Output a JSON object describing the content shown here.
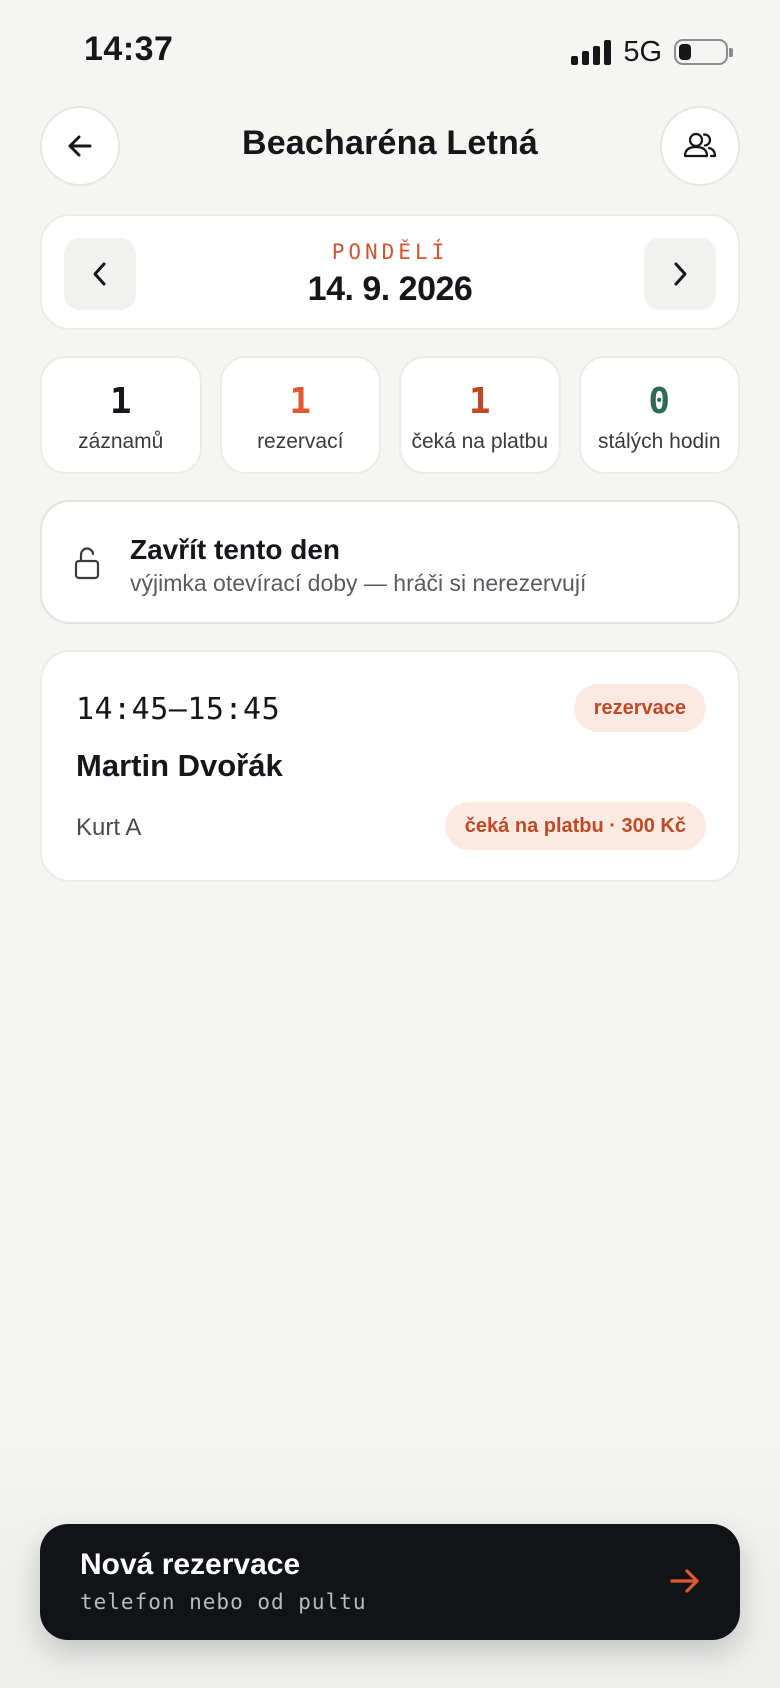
{
  "status_bar": {
    "time": "14:37",
    "network": "5G"
  },
  "header": {
    "title": "Beacharéna Letná",
    "back_icon": "arrow-left-icon",
    "people_icon": "users-icon"
  },
  "date_nav": {
    "weekday": "PONDĚLÍ",
    "date": "14. 9. 2026"
  },
  "stats": [
    {
      "value": "1",
      "label": "záznamů",
      "color": "#16171a"
    },
    {
      "value": "1",
      "label": "rezervací",
      "color": "#e05a2f"
    },
    {
      "value": "1",
      "label": "čeká na platbu",
      "color": "#c24724"
    },
    {
      "value": "0",
      "label": "stálých hodin",
      "color": "#2f6b58"
    }
  ],
  "close_day": {
    "title": "Zavřít tento den",
    "subtitle": "výjimka otevírací doby — hráči si nerezervují",
    "icon": "unlock-icon"
  },
  "booking": {
    "time": "14:45–15:45",
    "type": "rezervace",
    "name": "Martin Dvořák",
    "court": "Kurt A",
    "payment_status": "čeká na platbu · 300 Kč"
  },
  "cta": {
    "title": "Nová rezervace",
    "subtitle": "telefon nebo od pultu",
    "icon": "arrow-right-icon"
  },
  "colors": {
    "accent": "#e05a2f",
    "background": "#f5f5f3",
    "dark": "#111317"
  }
}
